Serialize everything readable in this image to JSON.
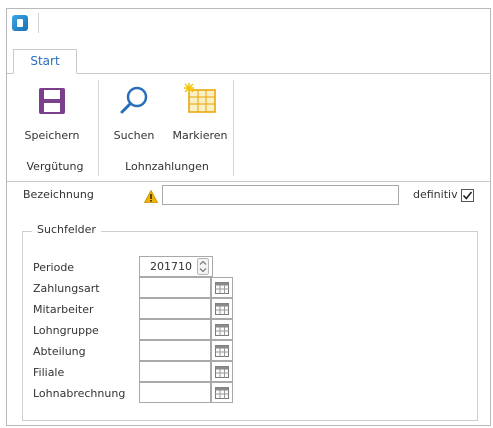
{
  "ribbon": {
    "tab": "Start",
    "buttons": {
      "save": "Speichern",
      "search": "Suchen",
      "mark": "Markieren"
    },
    "groups": {
      "verguetung": "Vergütung",
      "lohnzahlungen": "Lohnzahlungen"
    }
  },
  "form": {
    "bezeichnung_label": "Bezeichnung",
    "bezeichnung_value": "",
    "definitiv_label": "definitiv",
    "definitiv_checked": true
  },
  "suchfelder": {
    "title": "Suchfelder",
    "periode_label": "Periode",
    "periode_value": "201710",
    "fields": [
      {
        "label": "Zahlungsart",
        "value": ""
      },
      {
        "label": "Mitarbeiter",
        "value": ""
      },
      {
        "label": "Lohngruppe",
        "value": ""
      },
      {
        "label": "Abteilung",
        "value": ""
      },
      {
        "label": "Filiale",
        "value": ""
      },
      {
        "label": "Lohnabrechnung",
        "value": ""
      }
    ]
  },
  "colors": {
    "accent": "#2a6ebb",
    "save_icon": "#7b3f8c",
    "warning": "#e8a400"
  },
  "icons": {
    "save": "floppy-disk-icon",
    "search": "magnifier-icon",
    "mark": "highlight-table-icon",
    "warning": "warning-triangle-icon",
    "picker": "table-picker-icon",
    "spin": "spinner-arrows-icon"
  }
}
